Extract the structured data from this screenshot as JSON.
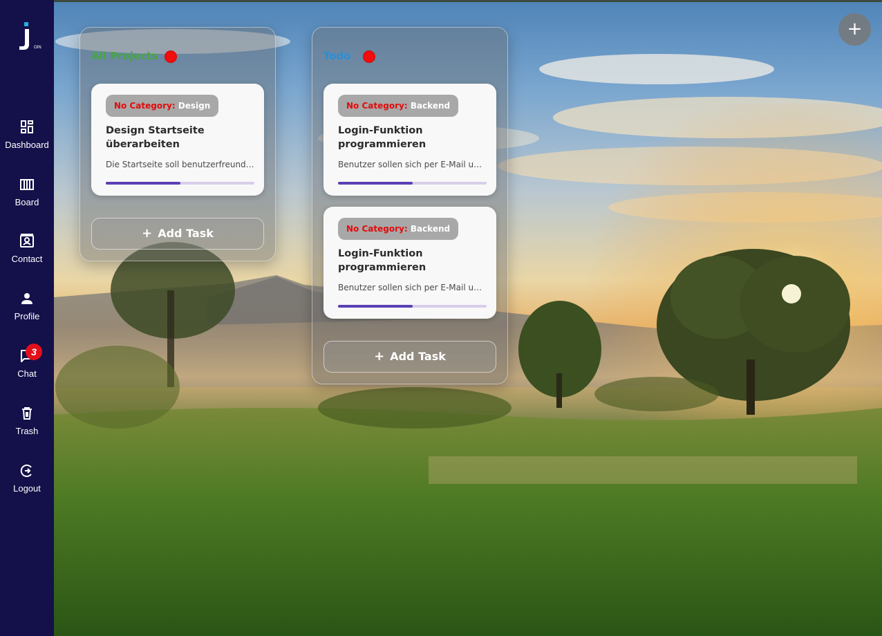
{
  "app": {
    "logo_text": "J",
    "logo_subtext": "OIN"
  },
  "sidebar": {
    "items": [
      {
        "label": "Dashboard",
        "icon": "dashboard-icon"
      },
      {
        "label": "Board",
        "icon": "board-icon"
      },
      {
        "label": "Contact",
        "icon": "contact-icon"
      },
      {
        "label": "Profile",
        "icon": "profile-icon"
      },
      {
        "label": "Chat",
        "icon": "chat-icon",
        "badge": "3"
      },
      {
        "label": "Trash",
        "icon": "trash-icon"
      },
      {
        "label": "Logout",
        "icon": "logout-icon"
      }
    ]
  },
  "columns": [
    {
      "title": "All Projects",
      "title_color": "#46a644",
      "cards": [
        {
          "category_label": "No Category:",
          "category": "Design",
          "title": "Design Startseite überarbeiten",
          "description": "Die Startseite soll benutzerfreundlich gestaltet werden",
          "progress": 0.5
        }
      ],
      "add_label": "Add Task"
    },
    {
      "title": "Todo",
      "title_color": "#2a8fd8",
      "cards": [
        {
          "category_label": "No Category:",
          "category": "Backend",
          "title": "Login-Funktion programmieren",
          "description": "Benutzer sollen sich per E-Mail und Passwort anmelden",
          "progress": 0.5
        },
        {
          "category_label": "No Category:",
          "category": "Backend",
          "title": "Login-Funktion programmieren",
          "description": "Benutzer sollen sich per E-Mail und Passwort anmelden",
          "progress": 0.5
        }
      ],
      "add_label": "Add Task"
    }
  ],
  "fab": {
    "label": "+"
  },
  "colors": {
    "sidebar": "#14104a",
    "dot": "#f20c0c",
    "progress": "#5b3fb5",
    "badge": "#e3101b"
  }
}
